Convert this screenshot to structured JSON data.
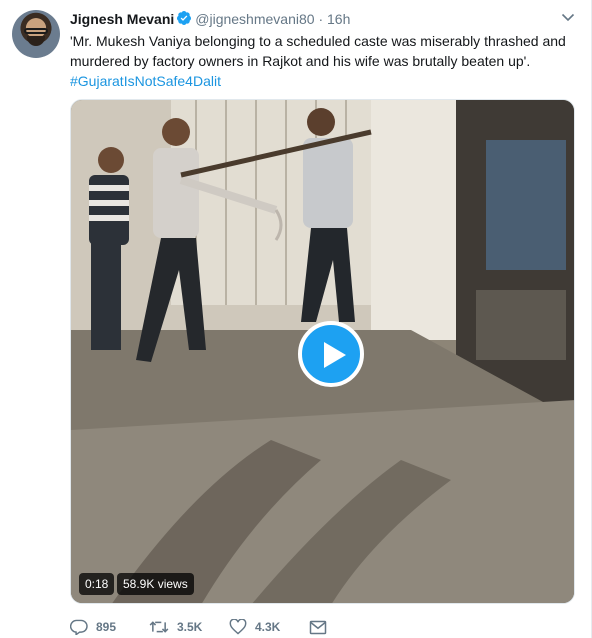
{
  "tweet": {
    "author_name": "Jignesh Mevani",
    "handle": "@jigneshmevani80",
    "separator": "·",
    "time": "16h",
    "text": "'Mr. Mukesh Vaniya belonging to a scheduled caste was miserably thrashed and murdered by factory owners in Rajkot and his wife was brutally beaten up'.",
    "hashtag": "#GujaratIsNotSafe4Dalit",
    "verified_icon": "verified-badge-icon",
    "menu_icon": "chevron-down-icon"
  },
  "media": {
    "duration": "0:18",
    "views": "58.9K views",
    "play_icon": "play-icon"
  },
  "actions": {
    "replies": "895",
    "retweets": "3.5K",
    "likes": "4.3K"
  },
  "colors": {
    "accent": "#1da1f2",
    "link": "#1b95e0",
    "muted": "#657786"
  }
}
